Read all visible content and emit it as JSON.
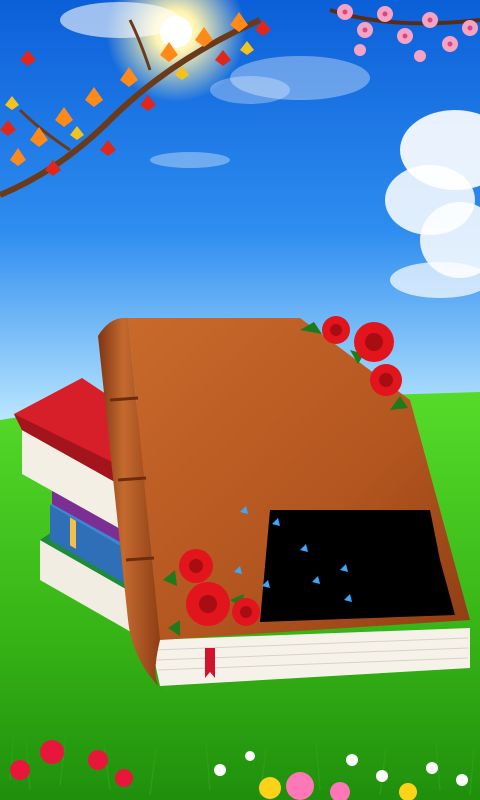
{
  "scene": {
    "colors": {
      "sky_top": "#0b5fd8",
      "sky_bottom": "#b9e6ff",
      "grass_top": "#4bd11f",
      "grass_bottom": "#1f8f0c",
      "book_cover": "#b75a22",
      "book_cover_dark": "#7f3512",
      "pages": "#f6f2ea",
      "bookmark": "#d3132b",
      "rose": "#e2141c",
      "leaf": "#1f7a1a",
      "sun": "#fff4b0"
    },
    "elements": [
      "sun-icon",
      "cloud-icon",
      "autumn-branch-icon",
      "blossom-branch-icon",
      "stacked-books-icon",
      "leather-book-icon",
      "rose-icon",
      "butterfly-icon",
      "flower-icon"
    ]
  }
}
